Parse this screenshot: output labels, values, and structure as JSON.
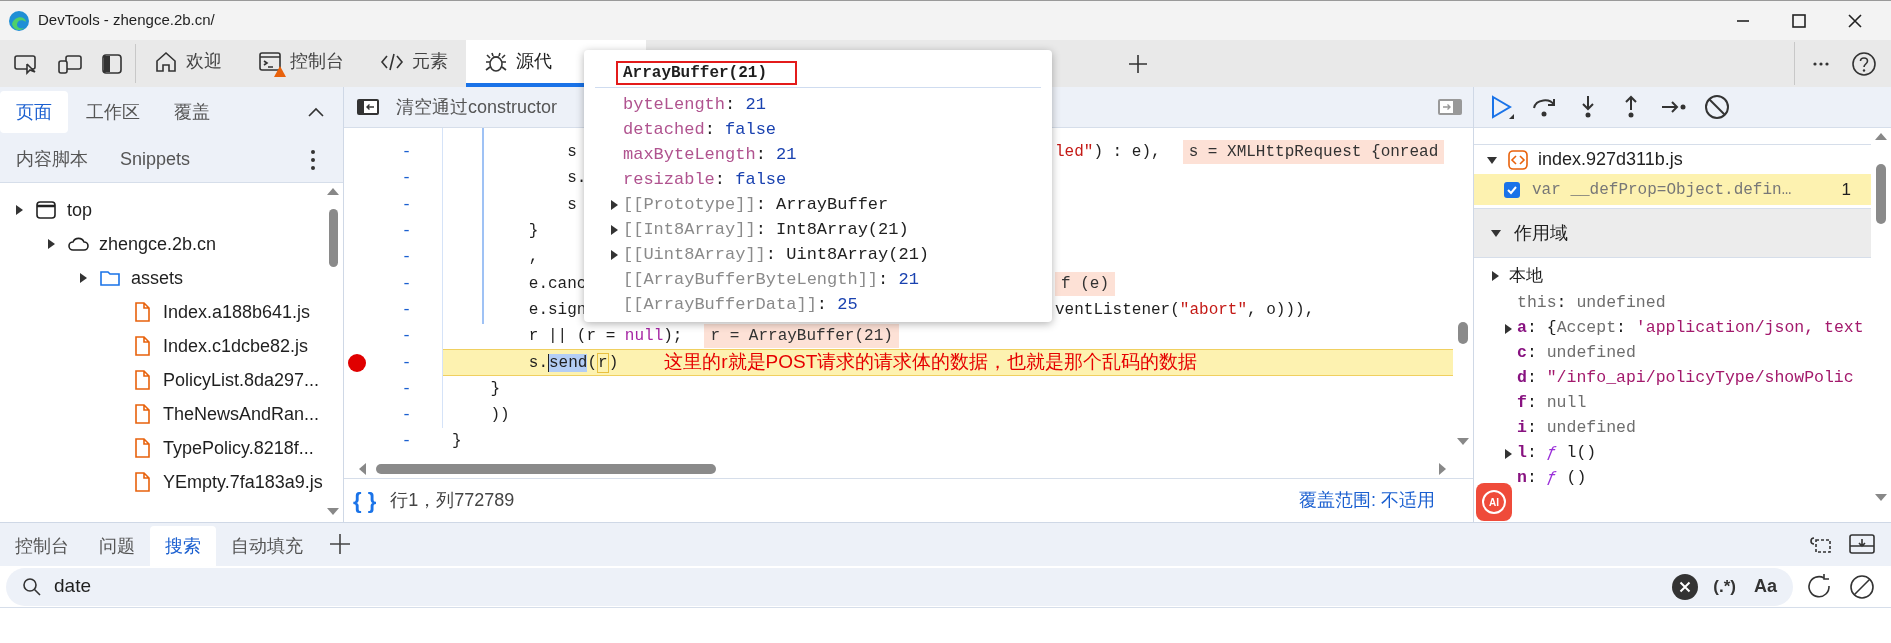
{
  "window": {
    "title": "DevTools - zhengce.2b.cn/"
  },
  "main_tabs": [
    {
      "label": "欢迎",
      "selected": false,
      "warning": false
    },
    {
      "label": "控制台",
      "selected": false,
      "warning": true
    },
    {
      "label": "元素",
      "selected": false,
      "warning": false
    },
    {
      "label": "源代",
      "selected": true,
      "warning": false
    }
  ],
  "navigator": {
    "tabs": [
      {
        "label": "页面",
        "selected": true
      },
      {
        "label": "工作区",
        "selected": false
      },
      {
        "label": "覆盖",
        "selected": false
      }
    ],
    "more_tabs": [
      "内容脚本",
      "Snippets"
    ],
    "tree": [
      {
        "label": "top",
        "kind": "frame",
        "expanded": false,
        "children": [
          {
            "label": "zhengce.2b.cn",
            "kind": "domain",
            "expanded": false,
            "children": [
              {
                "label": "assets",
                "kind": "folder",
                "expanded": false,
                "children": [
                  {
                    "label": "Index.a188b641.js",
                    "kind": "file"
                  },
                  {
                    "label": "Index.c1dcbe82.js",
                    "kind": "file"
                  },
                  {
                    "label": "PolicyList.8da297...",
                    "kind": "file"
                  },
                  {
                    "label": "TheNewsAndRan...",
                    "kind": "file"
                  },
                  {
                    "label": "TypePolicy.8218f...",
                    "kind": "file"
                  },
                  {
                    "label": "YEmpty.7fa183a9.js",
                    "kind": "file"
                  }
                ]
              }
            ]
          }
        ]
      }
    ]
  },
  "editor": {
    "header": "清空通过constructor",
    "lines": [
      {
        "kind": "split",
        "number": "-",
        "breakpoint": false,
        "left": [
          {
            "text": "            s",
            "kind": "plain"
          }
        ],
        "right": [
          {
            "text": "led\"",
            "kind": "string"
          },
          {
            "text": ") : e),",
            "kind": "plain"
          }
        ],
        "value": "s = XMLHttpRequest {onread"
      },
      {
        "kind": "split",
        "number": "-",
        "breakpoint": false,
        "left": [
          {
            "text": "            s.",
            "kind": "plain"
          }
        ]
      },
      {
        "kind": "split",
        "number": "-",
        "breakpoint": false,
        "left": [
          {
            "text": "            s",
            "kind": "plain"
          }
        ]
      },
      {
        "kind": "split",
        "number": "-",
        "breakpoint": false,
        "left": [
          {
            "text": "        }",
            "kind": "plain"
          }
        ]
      },
      {
        "kind": "split",
        "number": "-",
        "breakpoint": false,
        "left": [
          {
            "text": "        ,",
            "kind": "plain"
          }
        ]
      },
      {
        "kind": "split",
        "number": "-",
        "breakpoint": false,
        "left": [
          {
            "text": "        e.canc",
            "kind": "plain"
          }
        ],
        "value": "f (e)"
      },
      {
        "kind": "split",
        "number": "-",
        "breakpoint": false,
        "left": [
          {
            "text": "        e.sign",
            "kind": "plain"
          }
        ],
        "right": [
          {
            "text": "ventListener(",
            "kind": "plain"
          },
          {
            "text": "\"abort\"",
            "kind": "string"
          },
          {
            "text": ", o))),",
            "kind": "plain"
          }
        ]
      },
      {
        "kind": "full",
        "number": "-",
        "breakpoint": false,
        "tokens": [
          {
            "text": "        r || (r = ",
            "kind": "plain"
          },
          {
            "text": "null",
            "kind": "keyword"
          },
          {
            "text": ");",
            "kind": "plain"
          }
        ],
        "value": "r = ArrayBuffer(21)"
      },
      {
        "kind": "paused",
        "number": "-",
        "breakpoint": true,
        "prefix": "        s.",
        "selection": "send",
        "open": "(",
        "arg": "r",
        "close": ")",
        "note": "这里的r就是POST请求的请求体的数据，也就是那个乱码的数据"
      },
      {
        "kind": "full",
        "number": "-",
        "breakpoint": false,
        "tokens": [
          {
            "text": "    }",
            "kind": "plain"
          }
        ]
      },
      {
        "kind": "full",
        "number": "-",
        "breakpoint": false,
        "tokens": [
          {
            "text": "    ))",
            "kind": "plain"
          }
        ]
      },
      {
        "kind": "full",
        "number": "-",
        "breakpoint": false,
        "tokens": [
          {
            "text": "}",
            "kind": "plain"
          }
        ]
      }
    ],
    "format_button": "{ }",
    "position": "行1，列772789",
    "coverage": "覆盖范围: 不适用"
  },
  "popup": {
    "title": "ArrayBuffer(21)",
    "rows": [
      {
        "expandable": false,
        "tokens": [
          {
            "text": "byteLength",
            "kind": "prop"
          },
          {
            "text": ": ",
            "kind": "plain"
          },
          {
            "text": "21",
            "kind": "number"
          }
        ]
      },
      {
        "expandable": false,
        "tokens": [
          {
            "text": "detached",
            "kind": "prop"
          },
          {
            "text": ": ",
            "kind": "plain"
          },
          {
            "text": "false",
            "kind": "number"
          }
        ]
      },
      {
        "expandable": false,
        "tokens": [
          {
            "text": "maxByteLength",
            "kind": "prop"
          },
          {
            "text": ": ",
            "kind": "plain"
          },
          {
            "text": "21",
            "kind": "number"
          }
        ]
      },
      {
        "expandable": false,
        "tokens": [
          {
            "text": "resizable",
            "kind": "prop"
          },
          {
            "text": ": ",
            "kind": "plain"
          },
          {
            "text": "false",
            "kind": "number"
          }
        ]
      },
      {
        "expandable": true,
        "tokens": [
          {
            "text": "[[Prototype]]",
            "kind": "internal"
          },
          {
            "text": ": ArrayBuffer",
            "kind": "plain"
          }
        ]
      },
      {
        "expandable": true,
        "tokens": [
          {
            "text": "[[Int8Array]]",
            "kind": "internal"
          },
          {
            "text": ": Int8Array(21)",
            "kind": "plain"
          }
        ]
      },
      {
        "expandable": true,
        "tokens": [
          {
            "text": "[[Uint8Array]]",
            "kind": "internal"
          },
          {
            "text": ": Uint8Array(21)",
            "kind": "plain"
          }
        ]
      },
      {
        "expandable": false,
        "tokens": [
          {
            "text": "[[ArrayBufferByteLength]]",
            "kind": "internal"
          },
          {
            "text": ": ",
            "kind": "plain"
          },
          {
            "text": "21",
            "kind": "number"
          }
        ]
      },
      {
        "expandable": false,
        "tokens": [
          {
            "text": "[[ArrayBufferData]]",
            "kind": "internal"
          },
          {
            "text": ": ",
            "kind": "plain"
          },
          {
            "text": "25",
            "kind": "number"
          }
        ]
      }
    ]
  },
  "debugger": {
    "file": "index.927d311b.js",
    "file_expanded": true,
    "breakpoints": [
      {
        "code": "var __defProp=Object.defin…",
        "line": "1",
        "checked": true
      }
    ],
    "scope_title": "作用域",
    "scope_expanded": true,
    "local_title": "本地",
    "local_expanded": false,
    "variables": [
      {
        "expandable": false,
        "tokens": [
          {
            "text": "this",
            "kind": "grey"
          },
          {
            "text": ": ",
            "kind": "plain"
          },
          {
            "text": "undefined",
            "kind": "grey"
          }
        ]
      },
      {
        "expandable": true,
        "tokens": [
          {
            "text": "a",
            "kind": "key"
          },
          {
            "text": ": {",
            "kind": "plain"
          },
          {
            "text": "Accept",
            "kind": "grey"
          },
          {
            "text": ": ",
            "kind": "plain"
          },
          {
            "text": "'application/json, text",
            "kind": "string"
          }
        ]
      },
      {
        "expandable": false,
        "tokens": [
          {
            "text": "c",
            "kind": "key"
          },
          {
            "text": ": ",
            "kind": "plain"
          },
          {
            "text": "undefined",
            "kind": "grey"
          }
        ]
      },
      {
        "expandable": false,
        "tokens": [
          {
            "text": "d",
            "kind": "key"
          },
          {
            "text": ": ",
            "kind": "plain"
          },
          {
            "text": "\"/info_api/policyType/showPolic",
            "kind": "string"
          }
        ]
      },
      {
        "expandable": false,
        "tokens": [
          {
            "text": "f",
            "kind": "key"
          },
          {
            "text": ": ",
            "kind": "plain"
          },
          {
            "text": "null",
            "kind": "grey"
          }
        ]
      },
      {
        "expandable": false,
        "tokens": [
          {
            "text": "i",
            "kind": "key"
          },
          {
            "text": ": ",
            "kind": "plain"
          },
          {
            "text": "undefined",
            "kind": "grey"
          }
        ]
      },
      {
        "expandable": true,
        "tokens": [
          {
            "text": "l",
            "kind": "key"
          },
          {
            "text": ": ",
            "kind": "plain"
          },
          {
            "text": "ƒ",
            "kind": "fn"
          },
          {
            "text": " l()",
            "kind": "plain"
          }
        ]
      },
      {
        "expandable": false,
        "tokens": [
          {
            "text": "n",
            "kind": "key"
          },
          {
            "text": ": ",
            "kind": "plain"
          },
          {
            "text": "ƒ",
            "kind": "fn"
          },
          {
            "text": " ()",
            "kind": "plain"
          }
        ]
      }
    ]
  },
  "ai_button": "AI",
  "drawer": {
    "tabs": [
      {
        "label": "控制台",
        "selected": false
      },
      {
        "label": "问题",
        "selected": false
      },
      {
        "label": "搜索",
        "selected": true
      },
      {
        "label": "自动填充",
        "selected": false
      }
    ],
    "search": {
      "value": "date",
      "regex": "(.*)",
      "case": "Aa"
    }
  }
}
